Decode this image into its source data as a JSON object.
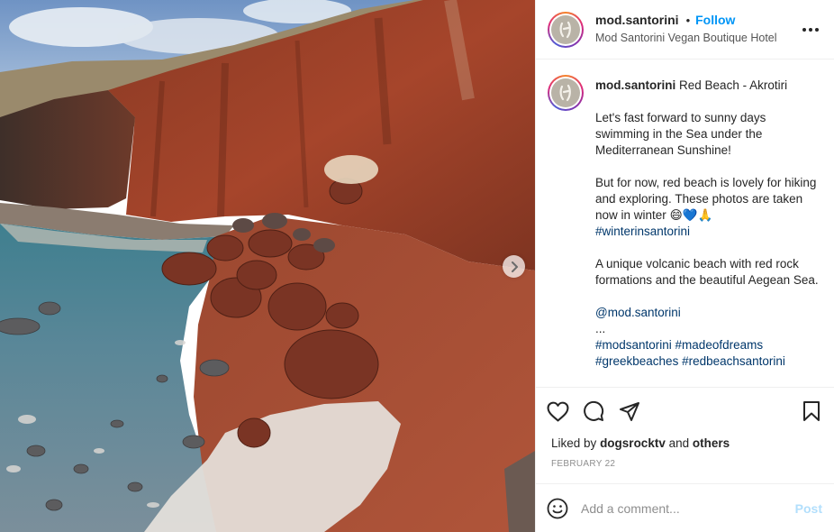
{
  "post": {
    "username": "mod.santorini",
    "follow_label": "Follow",
    "separator": "•",
    "location": "Mod Santorini Vegan Boutique Hotel"
  },
  "caption": {
    "username": "mod.santorini",
    "title": "Red Beach - Akrotiri",
    "p1": "Let's fast forward to sunny days swimming in the Sea under the Mediterranean Sunshine!",
    "p2": "But for now, red beach is lovely for hiking and exploring. These photos are taken now in winter",
    "p2_emoji": "😄💙🙏",
    "p2_tag": "#winterinsantorini",
    "p3": "A unique volcanic beach with red rock formations and the beautiful Aegean Sea.",
    "mention": "@mod.santorini",
    "ellipsis": "...",
    "hashtags_line1": "#modsantorini #madeofdreams",
    "hashtags_line2": "#greekbeaches #redbeachsantorini"
  },
  "likes": {
    "prefix": "Liked by",
    "user": "dogsrocktv",
    "connector": "and",
    "others": "others"
  },
  "date": "FEBRUARY 22",
  "comment": {
    "placeholder": "Add a comment...",
    "post_label": "Post"
  },
  "icons": {
    "like": "heart-icon",
    "comment": "comment-icon",
    "share": "paper-plane-icon",
    "save": "bookmark-icon",
    "more": "more-options-icon",
    "emoji": "emoji-icon",
    "next": "chevron-right-icon"
  },
  "colors": {
    "accent": "#0095f6",
    "post_disabled": "#b2dffc",
    "link": "#00376b",
    "meta": "#8e8e8e",
    "border": "#efefef"
  }
}
